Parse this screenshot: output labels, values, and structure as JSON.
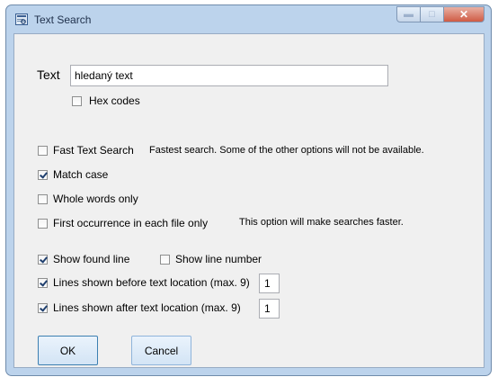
{
  "window": {
    "title": "Text Search",
    "icon": "app-icon",
    "caption": {
      "minimize": "minimize-icon",
      "maximize": "maximize-icon",
      "close": "close-icon"
    }
  },
  "search": {
    "label": "Text",
    "value": "hledaný text"
  },
  "options": {
    "hex_codes": {
      "label": "Hex codes",
      "checked": false
    },
    "fast_text_search": {
      "label": "Fast Text Search",
      "checked": false,
      "hint": "Fastest search. Some of the other options will not be available."
    },
    "match_case": {
      "label": "Match case",
      "checked": true
    },
    "whole_words_only": {
      "label": "Whole words only",
      "checked": false
    },
    "first_occurrence": {
      "label": "First occurrence in each file only",
      "checked": false,
      "hint": "This option will make searches faster."
    },
    "show_found_line": {
      "label": "Show found line",
      "checked": true
    },
    "show_line_number": {
      "label": "Show line number",
      "checked": false
    },
    "lines_before": {
      "label": "Lines shown before text location (max. 9)",
      "checked": true,
      "value": "1"
    },
    "lines_after": {
      "label": "Lines shown after text location (max. 9)",
      "checked": true,
      "value": "1"
    }
  },
  "buttons": {
    "ok": "OK",
    "cancel": "Cancel"
  }
}
